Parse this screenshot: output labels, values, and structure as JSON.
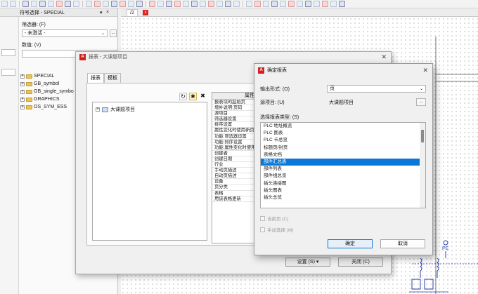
{
  "symbol_panel": {
    "title": "符号选择 - SPECIAL",
    "filter_label": "筛选器: (F)",
    "filter_value": "- 未激活 -",
    "filter_dots": "...",
    "count_label": "数值: (V)",
    "tree": [
      {
        "label": "SPECIAL"
      },
      {
        "label": "GB_symbol"
      },
      {
        "label": "GB_single_symbo"
      },
      {
        "label": "GRAPHICS"
      },
      {
        "label": "OS_SYM_ESS"
      }
    ]
  },
  "canvas": {
    "tab_label": "/2",
    "tab_close": "x"
  },
  "reports_dialog": {
    "title": "报表 - 大课题项目",
    "tabs": [
      "报表",
      "模板"
    ],
    "tree_root": "大课题项目",
    "properties_header": "属性",
    "properties": [
      "报表块的起始页",
      "增补说明:页码",
      "源项目",
      "筛选器设置",
      "排序设置",
      "属性变化时使用新页",
      "功能:筛选器设置",
      "功能:排序设置",
      "功能:属性变化时使用",
      "创建者",
      "创建日期",
      "行业",
      "手动页描述",
      "自动页描述",
      "设备",
      "页分类",
      "表格",
      "用该表格更新"
    ],
    "settings_button": "设置 (S)",
    "close_button": "关闭 (C)"
  },
  "determine_dialog": {
    "title": "确定报表",
    "output_label": "输出形式: (O)",
    "output_value": "页",
    "source_label": "源项目: (U)",
    "source_value": "大课题项目",
    "source_dots": "...",
    "type_label": "选择报表类型: (S)",
    "report_types": [
      "PLC 地址概览",
      "PLC 图表",
      "PLC 卡总览",
      "标题页/封页",
      "表格文档",
      "部件汇总表",
      "部件列表",
      "部件组总览",
      "插头连接图",
      "插头图表",
      "插头总览"
    ],
    "selected_index": 5,
    "current_page_label": "当前页 (C)",
    "manual_select_label": "手动选择 (M)",
    "ok_button": "确定",
    "cancel_button": "取消"
  },
  "schematic": {
    "label": "PE"
  }
}
